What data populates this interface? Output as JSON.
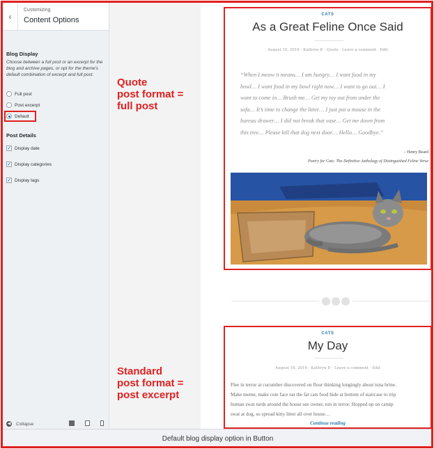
{
  "customizer": {
    "breadcrumb_small": "Customizing",
    "panel_title": "Content Options",
    "back_icon": "chevron-left-icon",
    "blog_display": {
      "heading": "Blog Display",
      "description": "Choose between a full post or an excerpt for the blog and archive pages, or opt for the theme's default combination of excerpt and full post.",
      "options": [
        {
          "label": "Full post",
          "checked": false
        },
        {
          "label": "Post excerpt",
          "checked": false
        },
        {
          "label": "Default",
          "checked": true
        }
      ]
    },
    "post_details": {
      "heading": "Post Details",
      "options": [
        {
          "label": "Display date",
          "checked": true
        },
        {
          "label": "Display categories",
          "checked": true
        },
        {
          "label": "Display tags",
          "checked": true
        }
      ]
    },
    "footer": {
      "collapse_label": "Collapse"
    }
  },
  "annotations": {
    "quote": [
      "Quote",
      "post format =",
      "full post"
    ],
    "standard": [
      "Standard",
      "post format =",
      "post excerpt"
    ]
  },
  "post1": {
    "category": "CATS",
    "title": "As a Great Feline Once Said",
    "meta": "August 19, 2016   ·   Kathryn P.   ·   Quote   ·   Leave a comment   ·   Edit",
    "quote_lines": [
      "“When I meow it means… I am hungry… I want food in my",
      "bowl… I want food in my bowl right now… I want to go out… I",
      "want to come in… Brush me… Get my toy out from under the",
      "sofa… It’s time to change the litter… I just put a mouse in the",
      "bureau drawer… I did not break that vase… Get me down from",
      "this tree… Please kill that dog next door… Hello… Goodbye.”"
    ],
    "author": "– Henry Beard",
    "source": "Poetry for Cats: The Definitive Anthology of Distinguished Feline Verse"
  },
  "post2": {
    "category": "CATS",
    "title": "My Day",
    "meta": "August 18, 2016   ·   Kathryn P.   ·   Leave a comment   ·   Edit",
    "excerpt_lines": [
      "Flee in terror at cucumber discovered on floor thinking longingly about tuna brine.",
      "Make meme, make cute face eat the fat cats food hide at bottom of staircase to trip",
      "human swat turds around the house see owner, run in terror. Hopped up on catnip",
      "swat at dog, so spread kitty litter all over house…"
    ],
    "continue": "Continue reading"
  },
  "caption": "Default blog display option in Button",
  "colors": {
    "annotation_red": "#e02020",
    "link_blue": "#2a7aa8",
    "sidebar_bg": "#eef1f4"
  }
}
